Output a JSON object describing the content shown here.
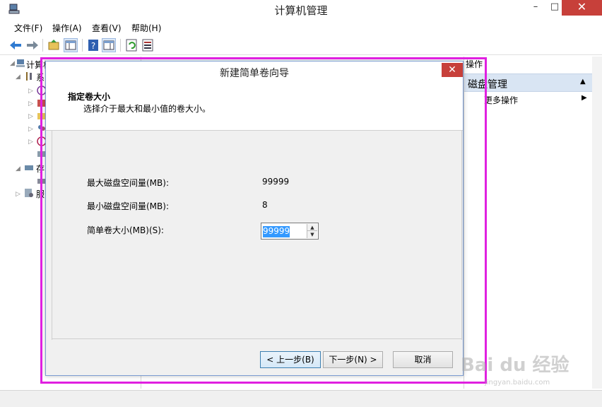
{
  "window": {
    "title": "计算机管理",
    "min": "–",
    "max": "□",
    "close": "✕"
  },
  "menu": [
    "文件(F)",
    "操作(A)",
    "查看(V)",
    "帮助(H)"
  ],
  "tree": {
    "root": "计算机",
    "items": [
      "系",
      "存",
      "服"
    ]
  },
  "actions": {
    "header": "操作",
    "section": "磁盘管理",
    "more": "更多操作"
  },
  "dialog": {
    "title": "新建简单卷向导",
    "heading": "指定卷大小",
    "subheading": "选择介于最大和最小值的卷大小。",
    "max_label": "最大磁盘空间量(MB):",
    "max_value": "99999",
    "min_label": "最小磁盘空间量(MB):",
    "min_value": "8",
    "size_label": "简单卷大小(MB)(S):",
    "size_value": "99999",
    "back_button": "< 上一步(B)",
    "next_button": "下一步(N) >",
    "cancel_button": "取消",
    "close": "✕"
  },
  "colors": {
    "highlight": "#e020e0",
    "close_red": "#c7403a",
    "selection_blue": "#3399ff"
  },
  "watermark": {
    "logo": "Bai du 经验",
    "url": "jingyan.baidu.com"
  }
}
